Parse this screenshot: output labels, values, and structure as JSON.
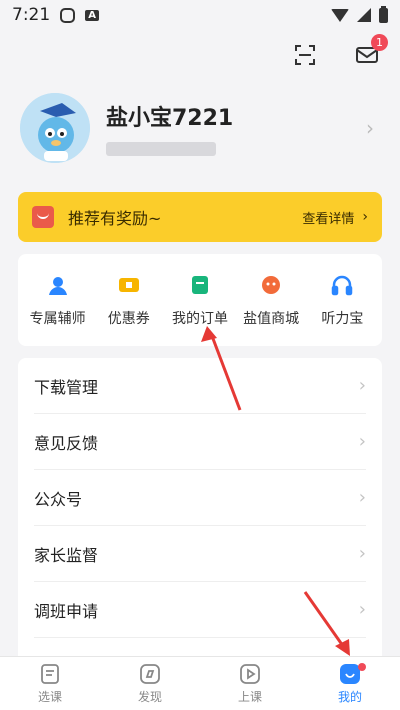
{
  "status_bar": {
    "time": "7:21"
  },
  "header": {
    "notification_count": "1"
  },
  "profile": {
    "username": "盐小宝7221"
  },
  "reward": {
    "title": "推荐有奖励~",
    "detail": "查看详情"
  },
  "quick_actions": [
    {
      "label": "专属辅师",
      "icon": "tutor-icon"
    },
    {
      "label": "优惠券",
      "icon": "coupon-icon"
    },
    {
      "label": "我的订单",
      "icon": "order-icon"
    },
    {
      "label": "盐值商城",
      "icon": "mall-icon"
    },
    {
      "label": "听力宝",
      "icon": "headphones-icon"
    }
  ],
  "menu": [
    {
      "label": "下载管理"
    },
    {
      "label": "意见反馈"
    },
    {
      "label": "公众号"
    },
    {
      "label": "家长监督"
    },
    {
      "label": "调班申请"
    }
  ],
  "tabs": [
    {
      "label": "选课",
      "icon": "course-icon"
    },
    {
      "label": "发现",
      "icon": "compass-icon"
    },
    {
      "label": "上课",
      "icon": "play-icon"
    },
    {
      "label": "我的",
      "icon": "profile-icon"
    }
  ],
  "colors": {
    "accent": "#2a86ff",
    "banner": "#fbcd2a",
    "badge": "#f04a58",
    "annotation": "#e53935"
  }
}
